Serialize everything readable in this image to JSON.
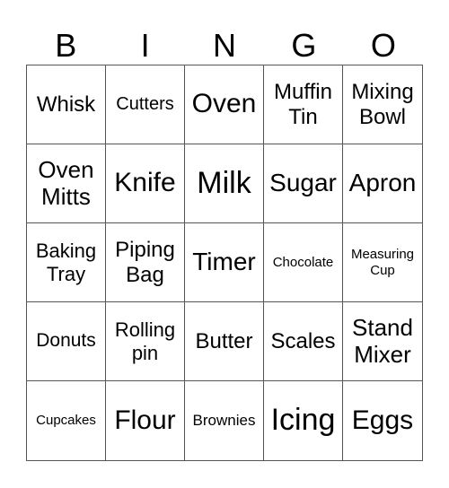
{
  "header": [
    "B",
    "I",
    "N",
    "G",
    "O"
  ],
  "cells": [
    {
      "text": "Whisk",
      "size": 24
    },
    {
      "text": "Cutters",
      "size": 20
    },
    {
      "text": "Oven",
      "size": 30
    },
    {
      "text": "Muffin Tin",
      "size": 24
    },
    {
      "text": "Mixing Bowl",
      "size": 24
    },
    {
      "text": "Oven Mitts",
      "size": 26
    },
    {
      "text": "Knife",
      "size": 30
    },
    {
      "text": "Milk",
      "size": 34
    },
    {
      "text": "Sugar",
      "size": 28
    },
    {
      "text": "Apron",
      "size": 28
    },
    {
      "text": "Baking Tray",
      "size": 22
    },
    {
      "text": "Piping Bag",
      "size": 24
    },
    {
      "text": "Timer",
      "size": 28
    },
    {
      "text": "Chocolate",
      "size": 15
    },
    {
      "text": "Measuring Cup",
      "size": 15
    },
    {
      "text": "Donuts",
      "size": 21
    },
    {
      "text": "Rolling pin",
      "size": 22
    },
    {
      "text": "Butter",
      "size": 24
    },
    {
      "text": "Scales",
      "size": 24
    },
    {
      "text": "Stand Mixer",
      "size": 26
    },
    {
      "text": "Cupcakes",
      "size": 15
    },
    {
      "text": "Flour",
      "size": 30
    },
    {
      "text": "Brownies",
      "size": 17
    },
    {
      "text": "Icing",
      "size": 34
    },
    {
      "text": "Eggs",
      "size": 30
    }
  ]
}
